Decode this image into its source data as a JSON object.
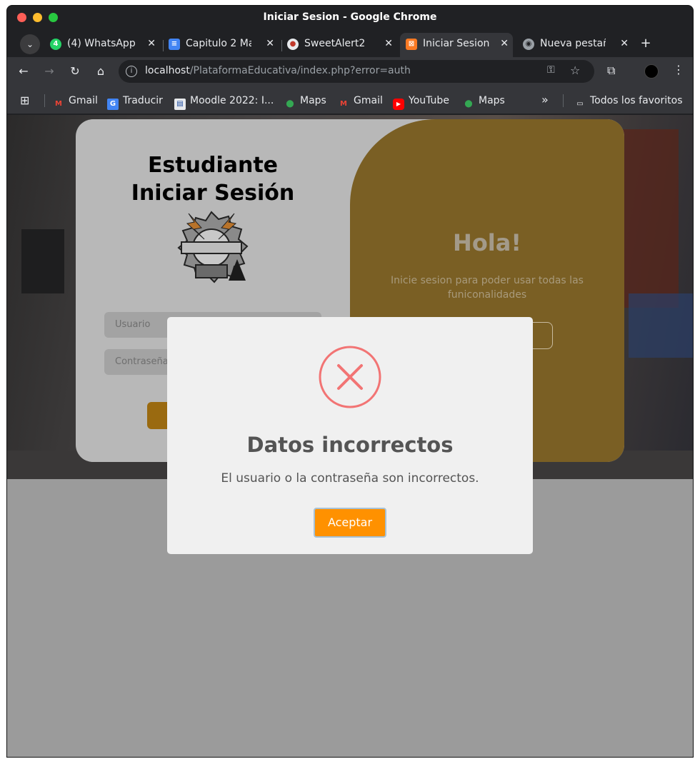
{
  "window": {
    "title": "Iniciar Sesion - Google Chrome"
  },
  "tabs": [
    {
      "label": "(4) WhatsApp",
      "icon": "whatsapp-icon",
      "active": false
    },
    {
      "label": "Capitulo 2 Ma",
      "icon": "docs-icon",
      "active": false
    },
    {
      "label": "SweetAlert2 -",
      "icon": "sweetalert-icon",
      "active": false
    },
    {
      "label": "Iniciar Sesion",
      "icon": "xampp-icon",
      "active": true
    },
    {
      "label": "Nueva pestañ",
      "icon": "chrome-icon",
      "active": false
    }
  ],
  "toolbar": {
    "url_host": "localhost",
    "url_path": "/PlataformaEducativa/index.php?error=auth"
  },
  "bookmarks": [
    {
      "label": "Gmail",
      "icon": "gmail-icon"
    },
    {
      "label": "Traducir",
      "icon": "translate-icon"
    },
    {
      "label": "Moodle 2022: I...",
      "icon": "moodle-icon"
    },
    {
      "label": "Maps",
      "icon": "maps-icon"
    },
    {
      "label": "Gmail",
      "icon": "gmail-icon"
    },
    {
      "label": "YouTube",
      "icon": "youtube-icon"
    },
    {
      "label": "Maps",
      "icon": "maps-icon"
    }
  ],
  "bookmarks_more": "»",
  "bookmarks_folder": "Todos los favoritos",
  "page": {
    "login_title_line1": "Estudiante",
    "login_title_line2": "Iniciar Sesión",
    "username_placeholder": "Usuario",
    "password_placeholder": "Contraseña",
    "hola_title": "Hola!",
    "hola_text": "Inicie sesion para poder usar todas las funiconalidades"
  },
  "modal": {
    "title": "Datos incorrectos",
    "text": "El usuario o la contraseña son incorrectos.",
    "confirm_label": "Aceptar",
    "icon": "error-x-icon",
    "icon_color": "#f27474",
    "button_color": "#ff9100"
  },
  "colors": {
    "brand_gold": "#7a5f24",
    "chrome_dark": "#202124",
    "chrome_toolbar": "#35363a"
  }
}
